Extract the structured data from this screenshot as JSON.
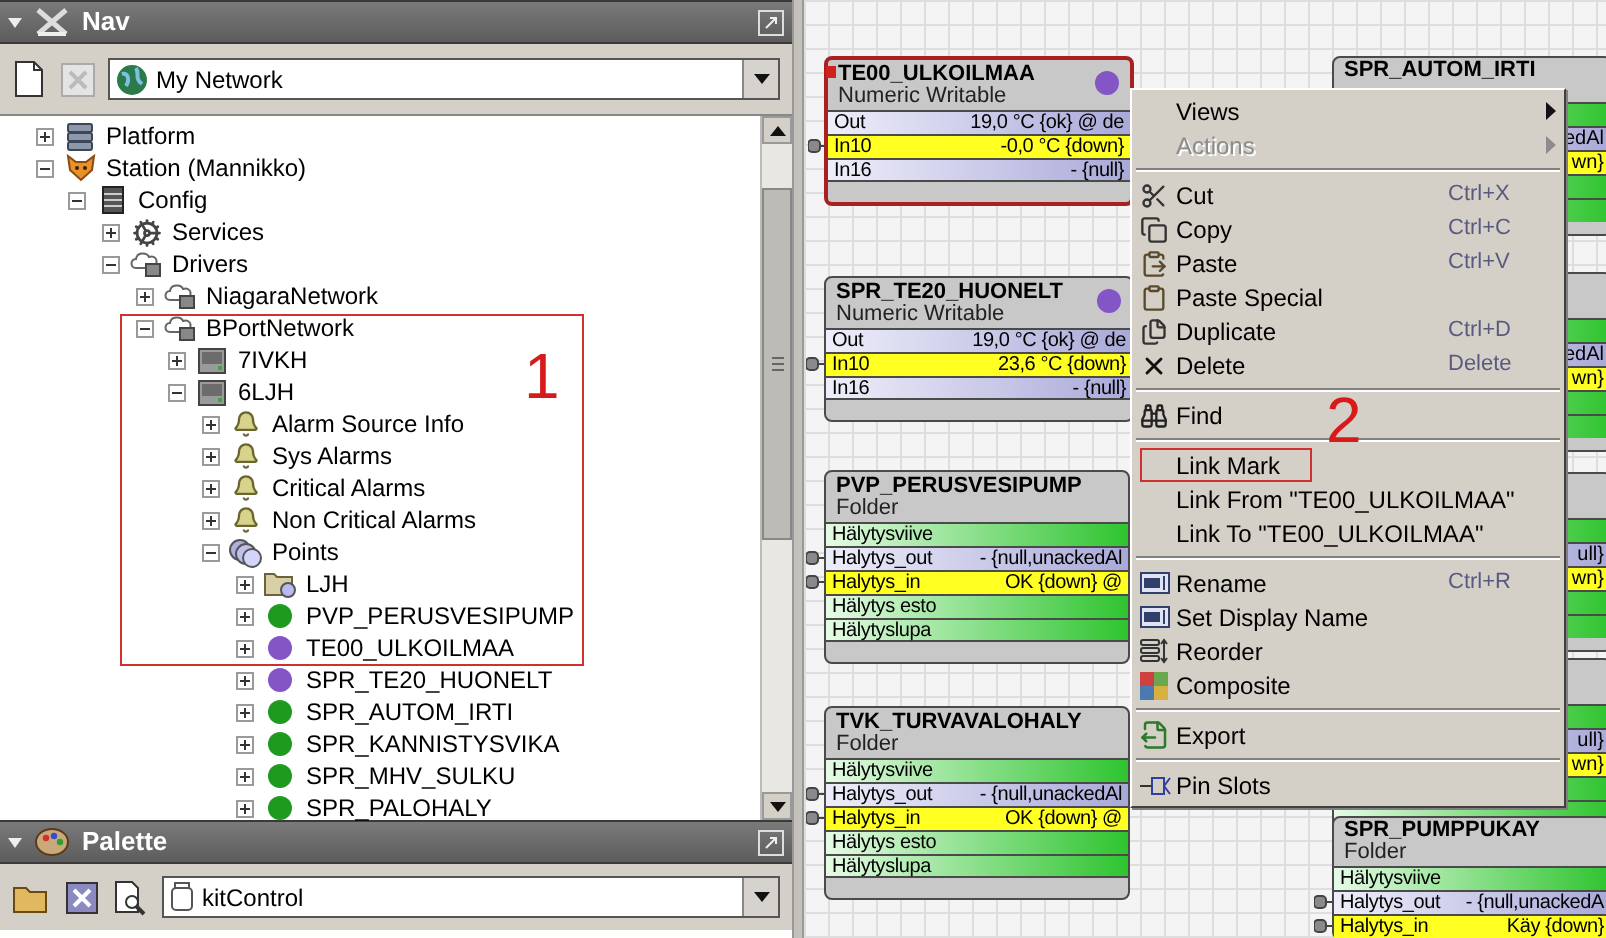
{
  "nav": {
    "title": "Nav",
    "location": "My Network",
    "annotation": "1",
    "tree": [
      {
        "label": "Platform",
        "kind": "platform",
        "expanded": false
      },
      {
        "label": "Station (Mannikko)",
        "kind": "station",
        "expanded": true,
        "children": [
          {
            "label": "Config",
            "kind": "config",
            "expanded": true,
            "children": [
              {
                "label": "Services",
                "kind": "services",
                "expanded": false
              },
              {
                "label": "Drivers",
                "kind": "network",
                "expanded": true,
                "children": [
                  {
                    "label": "NiagaraNetwork",
                    "kind": "network",
                    "expanded": false
                  },
                  {
                    "label": "BPortNetwork",
                    "kind": "network",
                    "expanded": true,
                    "children": [
                      {
                        "label": "7IVKH",
                        "kind": "device",
                        "expanded": false
                      },
                      {
                        "label": "6LJH",
                        "kind": "device",
                        "expanded": true,
                        "children": [
                          {
                            "label": "Alarm Source Info",
                            "kind": "alarm",
                            "expanded": false
                          },
                          {
                            "label": "Sys Alarms",
                            "kind": "alarm",
                            "expanded": false
                          },
                          {
                            "label": "Critical Alarms",
                            "kind": "alarm",
                            "expanded": false
                          },
                          {
                            "label": "Non Critical Alarms",
                            "kind": "alarm",
                            "expanded": false
                          },
                          {
                            "label": "Points",
                            "kind": "points",
                            "expanded": true,
                            "children": [
                              {
                                "label": "LJH",
                                "kind": "folder",
                                "expanded": false
                              },
                              {
                                "label": "PVP_PERUSVESIPUMP",
                                "kind": "point",
                                "color": "#1e9a1e",
                                "expanded": false
                              },
                              {
                                "label": "TE00_ULKOILMAA",
                                "kind": "point",
                                "color": "#8455c4",
                                "expanded": false
                              },
                              {
                                "label": "SPR_TE20_HUONELT",
                                "kind": "point",
                                "color": "#8455c4",
                                "expanded": false
                              },
                              {
                                "label": "SPR_AUTOM_IRTI",
                                "kind": "point",
                                "color": "#1e9a1e",
                                "expanded": false
                              },
                              {
                                "label": "SPR_KANNISTYSVIKA",
                                "kind": "point",
                                "color": "#1e9a1e",
                                "expanded": false
                              },
                              {
                                "label": "SPR_MHV_SULKU",
                                "kind": "point",
                                "color": "#1e9a1e",
                                "expanded": false
                              },
                              {
                                "label": "SPR_PALOHALY",
                                "kind": "point",
                                "color": "#1e9a1e",
                                "expanded": false
                              }
                            ]
                          }
                        ]
                      }
                    ]
                  }
                ]
              }
            ]
          }
        ]
      }
    ]
  },
  "palette": {
    "title": "Palette",
    "module": "kitControl"
  },
  "wiresheet": {
    "blocks": [
      {
        "name": "TE00_ULKOILMAA",
        "type": "Numeric Writable",
        "color": "#8455c4",
        "selected": true,
        "slots": [
          {
            "kind": "plain",
            "name": "Out",
            "value": "19,0 °C {ok} @ de",
            "pinned": false
          },
          {
            "kind": "highlight",
            "name": "In10",
            "value": "-0,0 °C {down}",
            "pinned": true
          },
          {
            "kind": "plain",
            "name": "In16",
            "value": "- {null}",
            "pinned": false
          }
        ]
      },
      {
        "name": "SPR_TE20_HUONELT",
        "type": "Numeric Writable",
        "color": "#8455c4",
        "selected": false,
        "slots": [
          {
            "kind": "plain",
            "name": "Out",
            "value": "19,0 °C {ok} @ de",
            "pinned": false
          },
          {
            "kind": "highlight",
            "name": "In10",
            "value": "23,6 °C {down}",
            "pinned": true
          },
          {
            "kind": "plain",
            "name": "In16",
            "value": "- {null}",
            "pinned": false
          }
        ]
      },
      {
        "name": "PVP_PERUSVESIPUMP",
        "type": "Folder",
        "selected": false,
        "slots": [
          {
            "kind": "folder",
            "name": "Hälytysviive",
            "pinned": false
          },
          {
            "kind": "plain",
            "name": "Halytys_out",
            "value": "- {null,unackedAl",
            "pinned": true
          },
          {
            "kind": "highlight",
            "name": "Halytys_in",
            "value": "OK {down} @",
            "pinned": true
          },
          {
            "kind": "folder",
            "name": "Hälytys esto",
            "pinned": false
          },
          {
            "kind": "folder",
            "name": "Hälytyslupa",
            "pinned": false
          }
        ]
      },
      {
        "name": "TVK_TURVAVALOHALY",
        "type": "Folder",
        "selected": false,
        "slots": [
          {
            "kind": "folder",
            "name": "Hälytysviive",
            "pinned": false
          },
          {
            "kind": "plain",
            "name": "Halytys_out",
            "value": "- {null,unackedAl",
            "pinned": true
          },
          {
            "kind": "highlight",
            "name": "Halytys_in",
            "value": "OK {down} @",
            "pinned": true
          },
          {
            "kind": "folder",
            "name": "Hälytys esto",
            "pinned": false
          },
          {
            "kind": "folder",
            "name": "Hälytyslupa",
            "pinned": false
          }
        ]
      },
      {
        "name": "SPR_PUMPPUKAY",
        "type": "Folder",
        "selected": false,
        "slots": [
          {
            "kind": "folder",
            "name": "Hälytysviive",
            "pinned": false
          },
          {
            "kind": "plain",
            "name": "Halytys_out",
            "value": "- {null,unackedA",
            "pinned": true
          },
          {
            "kind": "highlight",
            "name": "Halytys_in",
            "value": "Käy {down}",
            "pinned": true
          }
        ]
      }
    ],
    "side_blocks": [
      {
        "title": "SPR_AUTOM_IRTI",
        "rows": [
          {
            "kind": "folder"
          },
          {
            "kind": "plain",
            "text": "edAl"
          },
          {
            "kind": "highlight",
            "text": "wn}"
          },
          {
            "kind": "folder"
          },
          {
            "kind": "folder"
          }
        ]
      },
      {
        "rows": [
          {
            "kind": "folder"
          },
          {
            "kind": "plain",
            "text": "edAl"
          },
          {
            "kind": "highlight",
            "text": "wn}"
          },
          {
            "kind": "folder"
          },
          {
            "kind": "folder"
          }
        ]
      },
      {
        "rows": [
          {
            "kind": "folder"
          },
          {
            "kind": "plain",
            "text": "ull}"
          },
          {
            "kind": "highlight",
            "text": "wn}"
          },
          {
            "kind": "folder"
          },
          {
            "kind": "folder"
          }
        ]
      },
      {
        "rows": [
          {
            "kind": "folder"
          },
          {
            "kind": "plain",
            "text": "ull}"
          },
          {
            "kind": "highlight",
            "text": "wn}"
          },
          {
            "kind": "folder"
          },
          {
            "kind": "folder"
          }
        ]
      }
    ]
  },
  "context_menu": {
    "annotation": "2",
    "items": [
      {
        "kind": "plain",
        "label": "Views",
        "submenu": true,
        "disabled": false
      },
      {
        "kind": "plain",
        "label": "Actions",
        "submenu": true,
        "disabled": true
      },
      {
        "kind": "separator"
      },
      {
        "kind": "cut",
        "label": "Cut",
        "shortcut": "Ctrl+X",
        "disabled": false
      },
      {
        "kind": "copy",
        "label": "Copy",
        "shortcut": "Ctrl+C",
        "disabled": false
      },
      {
        "kind": "paste",
        "label": "Paste",
        "shortcut": "Ctrl+V",
        "disabled": false
      },
      {
        "kind": "paste_special",
        "label": "Paste Special",
        "disabled": false
      },
      {
        "kind": "duplicate",
        "label": "Duplicate",
        "shortcut": "Ctrl+D",
        "disabled": false
      },
      {
        "kind": "delete",
        "label": "Delete",
        "shortcut": "Delete",
        "disabled": false
      },
      {
        "kind": "separator"
      },
      {
        "kind": "find",
        "label": "Find",
        "disabled": false
      },
      {
        "kind": "separator"
      },
      {
        "kind": "plain",
        "label": "Link Mark",
        "annotated": true,
        "disabled": false
      },
      {
        "kind": "plain",
        "label": "Link From \"TE00_ULKOILMAA\"",
        "disabled": false
      },
      {
        "kind": "plain",
        "label": "Link To \"TE00_ULKOILMAA\"",
        "disabled": false
      },
      {
        "kind": "separator"
      },
      {
        "kind": "rename",
        "label": "Rename",
        "shortcut": "Ctrl+R",
        "disabled": false
      },
      {
        "kind": "rename",
        "label": "Set Display Name",
        "disabled": false
      },
      {
        "kind": "reorder",
        "label": "Reorder",
        "disabled": false
      },
      {
        "kind": "composite",
        "label": "Composite",
        "disabled": false
      },
      {
        "kind": "separator"
      },
      {
        "kind": "export",
        "label": "Export",
        "disabled": false
      },
      {
        "kind": "separator"
      },
      {
        "kind": "pin",
        "label": "Pin Slots",
        "disabled": false
      }
    ]
  }
}
